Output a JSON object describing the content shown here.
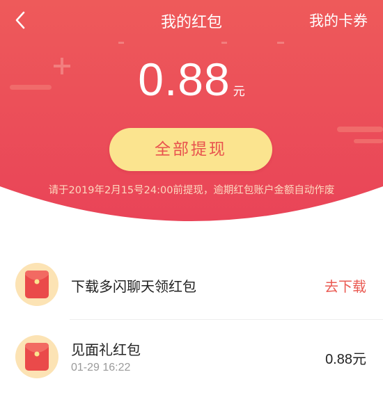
{
  "colors": {
    "header_top": "#ee5a5a",
    "header_bottom": "#e94458",
    "button_bg": "#fbe48f",
    "accent": "#ea5a52"
  },
  "nav": {
    "back_icon": "chevron-left-icon",
    "title": "我的红包",
    "coupons_link": "我的卡券"
  },
  "balance": {
    "amount": "0.88",
    "unit": "元"
  },
  "withdraw_button": {
    "label": "全部提现"
  },
  "notice": "请于2019年2月15号24:00前提现，逾期红包账户金额自动作废",
  "items": [
    {
      "icon": "red-envelope-icon",
      "title": "下载多闪聊天领红包",
      "action": "去下载"
    },
    {
      "icon": "red-envelope-icon",
      "title": "见面礼红包",
      "time": "01-29 16:22",
      "value": "0.88元"
    }
  ]
}
